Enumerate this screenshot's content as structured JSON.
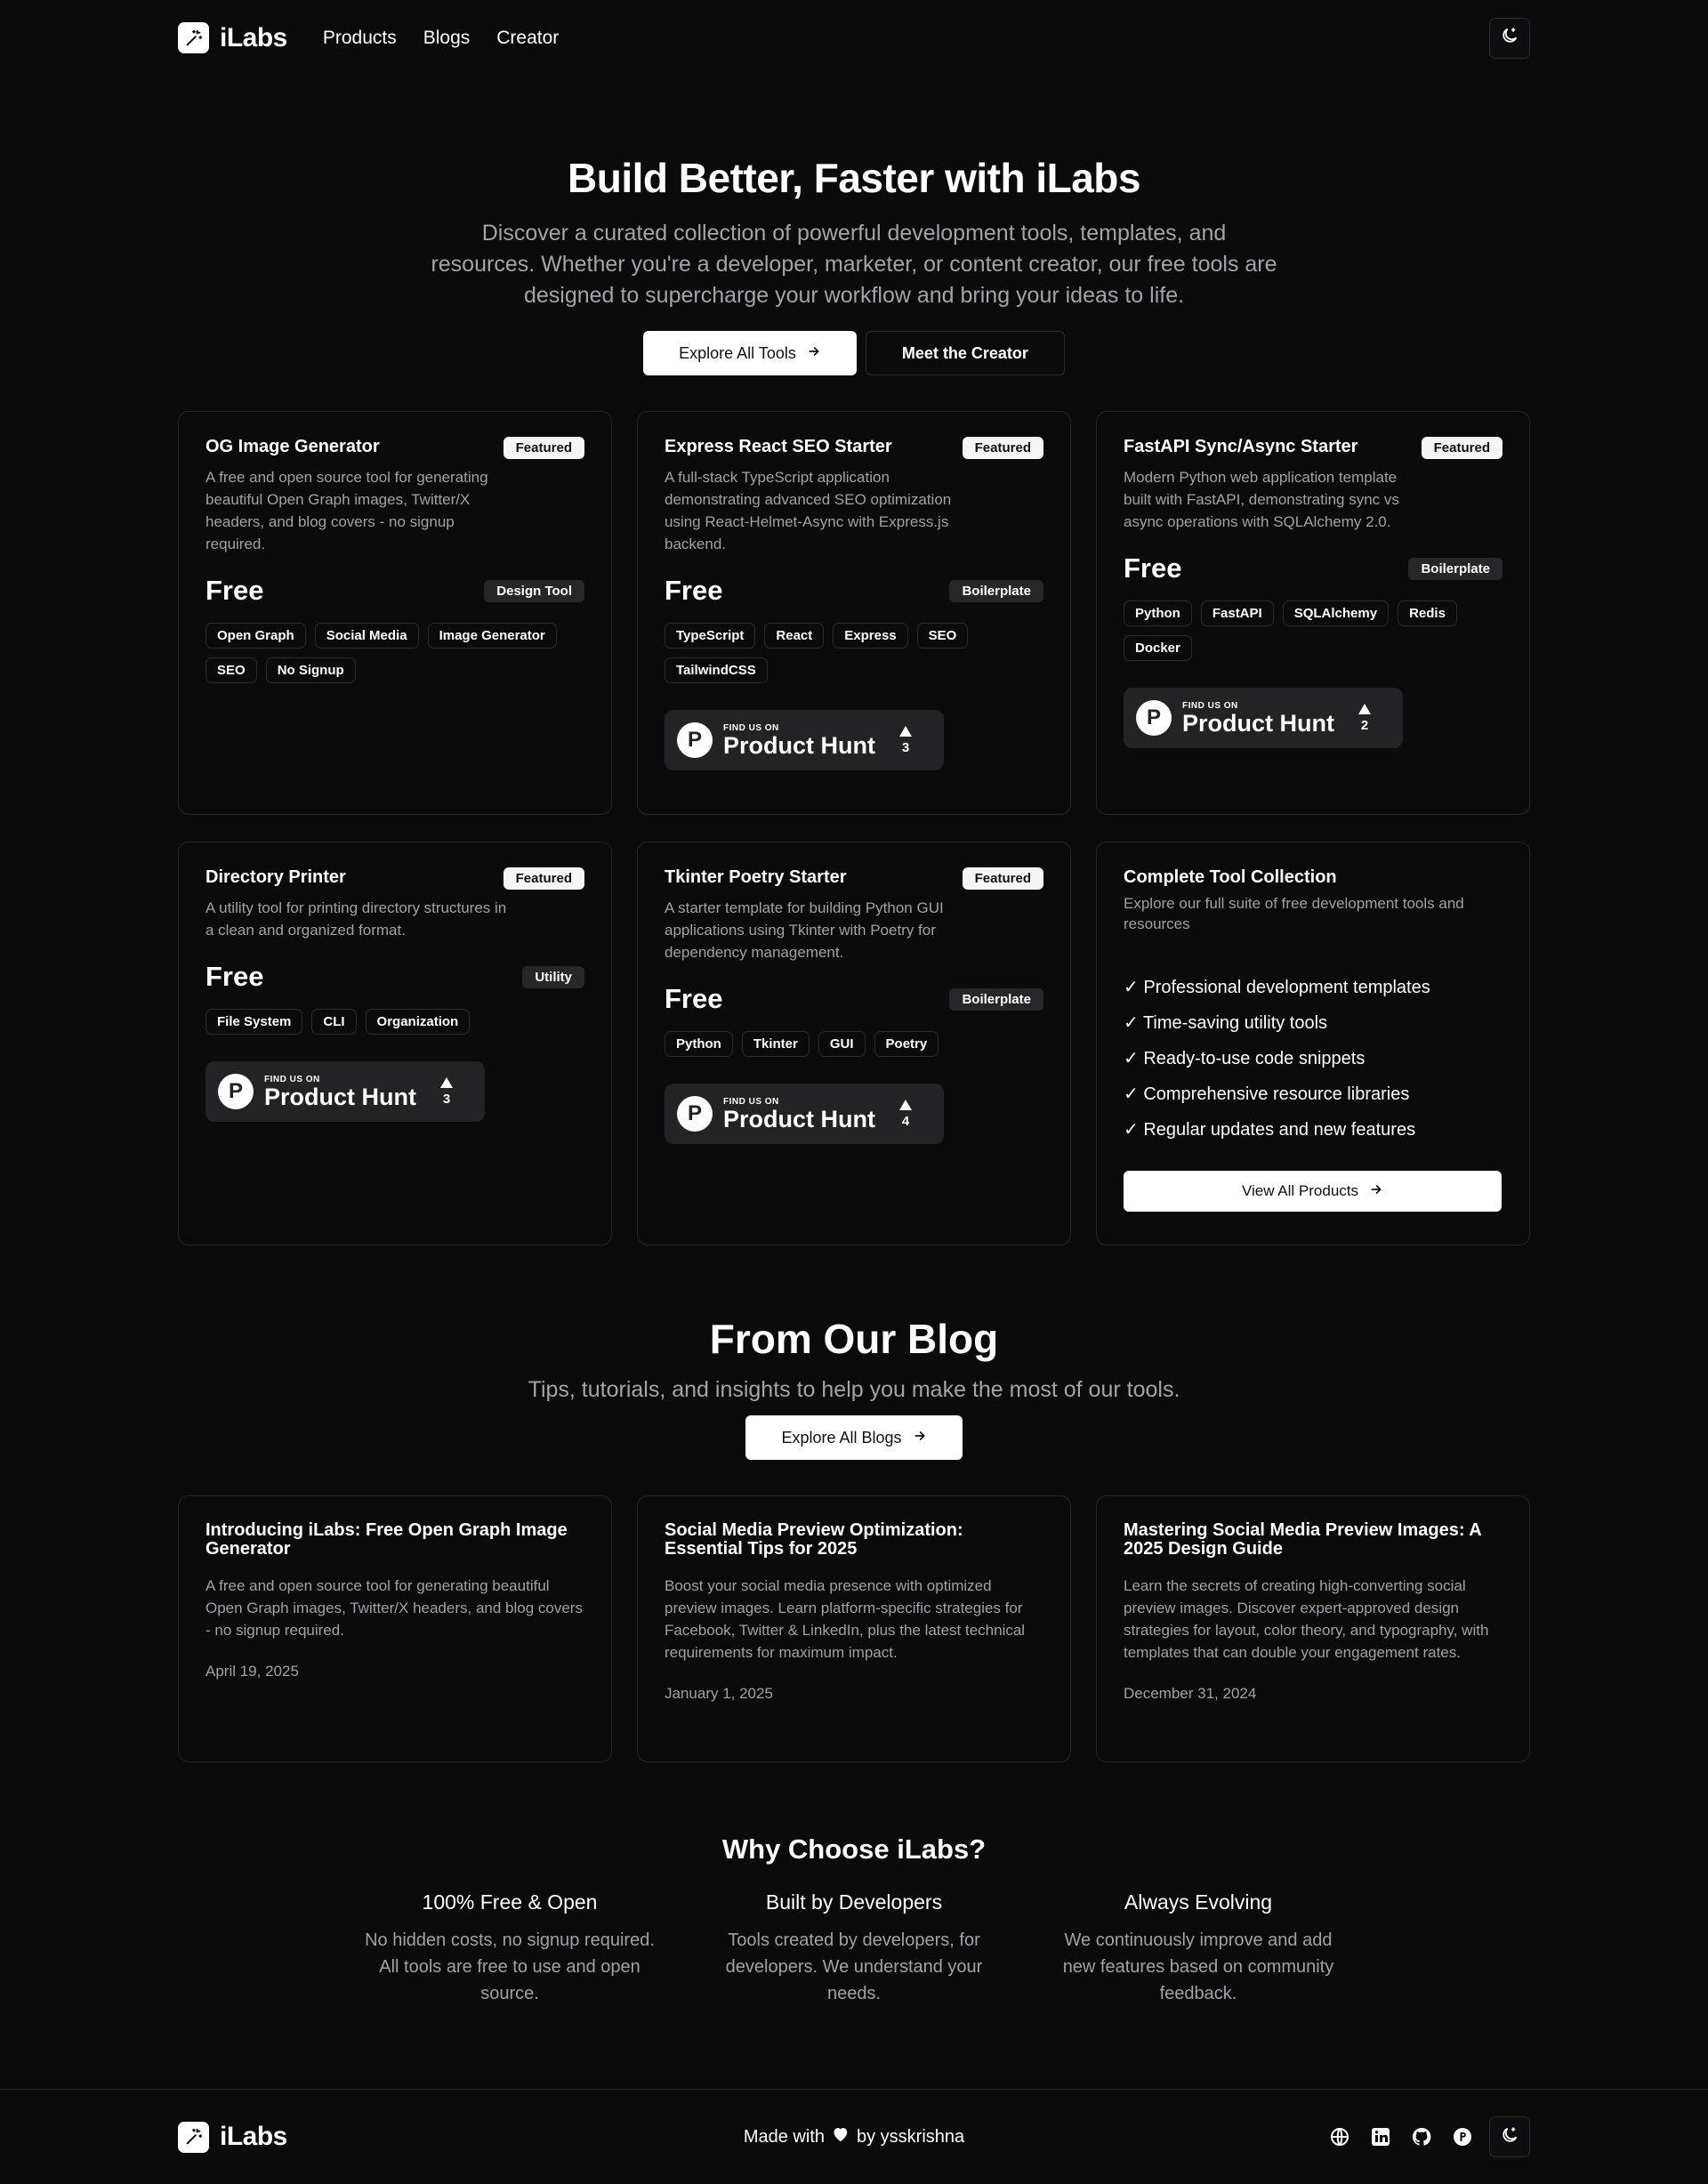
{
  "nav": {
    "brand": "iLabs",
    "links": [
      "Products",
      "Blogs",
      "Creator"
    ]
  },
  "hero": {
    "title": "Build Better, Faster with iLabs",
    "subtitle": "Discover a curated collection of powerful development tools, templates, and resources. Whether you're a developer, marketer, or content creator, our free tools are designed to supercharge your workflow and bring your ideas to life.",
    "primary_btn": "Explore All Tools",
    "secondary_btn": "Meet the Creator"
  },
  "products": [
    {
      "title": "OG Image Generator",
      "badge": "Featured",
      "desc": "A free and open source tool for generating beautiful Open Graph images, Twitter/X headers, and blog covers - no signup required.",
      "price": "Free",
      "category": "Design Tool",
      "tags": [
        "Open Graph",
        "Social Media",
        "Image Generator",
        "SEO",
        "No Signup"
      ]
    },
    {
      "title": "Express React SEO Starter",
      "badge": "Featured",
      "desc": "A full-stack TypeScript application demonstrating advanced SEO optimization using React-Helmet-Async with Express.js backend.",
      "price": "Free",
      "category": "Boilerplate",
      "tags": [
        "TypeScript",
        "React",
        "Express",
        "SEO",
        "TailwindCSS"
      ],
      "ph": {
        "small": "FIND US ON",
        "big": "Product Hunt",
        "votes": "3"
      }
    },
    {
      "title": "FastAPI Sync/Async Starter",
      "badge": "Featured",
      "desc": "Modern Python web application template built with FastAPI, demonstrating sync vs async operations with SQLAlchemy 2.0.",
      "price": "Free",
      "category": "Boilerplate",
      "tags": [
        "Python",
        "FastAPI",
        "SQLAlchemy",
        "Redis",
        "Docker"
      ],
      "ph": {
        "small": "FIND US ON",
        "big": "Product Hunt",
        "votes": "2"
      }
    },
    {
      "title": "Directory Printer",
      "badge": "Featured",
      "desc": "A utility tool for printing directory structures in a clean and organized format.",
      "price": "Free",
      "category": "Utility",
      "tags": [
        "File System",
        "CLI",
        "Organization"
      ],
      "ph": {
        "small": "FIND US ON",
        "big": "Product Hunt",
        "votes": "3"
      }
    },
    {
      "title": "Tkinter Poetry Starter",
      "badge": "Featured",
      "desc": "A starter template for building Python GUI applications using Tkinter with Poetry for dependency management.",
      "price": "Free",
      "category": "Boilerplate",
      "tags": [
        "Python",
        "Tkinter",
        "GUI",
        "Poetry"
      ],
      "ph": {
        "small": "FIND US ON",
        "big": "Product Hunt",
        "votes": "4"
      }
    }
  ],
  "collection": {
    "title": "Complete Tool Collection",
    "subtitle": "Explore our full suite of free development tools and resources",
    "features": [
      "✓ Professional development templates",
      "✓ Time-saving utility tools",
      "✓ Ready-to-use code snippets",
      "✓ Comprehensive resource libraries",
      "✓ Regular updates and new features"
    ],
    "btn": "View All Products"
  },
  "blog": {
    "title": "From Our Blog",
    "subtitle": "Tips, tutorials, and insights to help you make the most of our tools.",
    "btn": "Explore All Blogs",
    "posts": [
      {
        "title": "Introducing iLabs: Free Open Graph Image Generator",
        "desc": "A free and open source tool for generating beautiful Open Graph images, Twitter/X headers, and blog covers - no signup required.",
        "date": "April 19, 2025"
      },
      {
        "title": "Social Media Preview Optimization: Essential Tips for 2025",
        "desc": "Boost your social media presence with optimized preview images. Learn platform-specific strategies for Facebook, Twitter & LinkedIn, plus the latest technical requirements for maximum impact.",
        "date": "January 1, 2025"
      },
      {
        "title": "Mastering Social Media Preview Images: A 2025 Design Guide",
        "desc": "Learn the secrets of creating high-converting social preview images. Discover expert-approved design strategies for layout, color theory, and typography, with templates that can double your engagement rates.",
        "date": "December 31, 2024"
      }
    ]
  },
  "why": {
    "title": "Why Choose iLabs?",
    "items": [
      {
        "title": "100% Free & Open",
        "desc": "No hidden costs, no signup required. All tools are free to use and open source."
      },
      {
        "title": "Built by Developers",
        "desc": "Tools created by developers, for developers. We understand your needs."
      },
      {
        "title": "Always Evolving",
        "desc": "We continuously improve and add new features based on community feedback."
      }
    ]
  },
  "footer": {
    "brand": "iLabs",
    "made_with": "Made with",
    "by": "by ysskrishna",
    "social_icons": [
      "globe-icon",
      "linkedin-icon",
      "github-icon",
      "producthunt-icon",
      "theme-toggle-icon"
    ]
  }
}
